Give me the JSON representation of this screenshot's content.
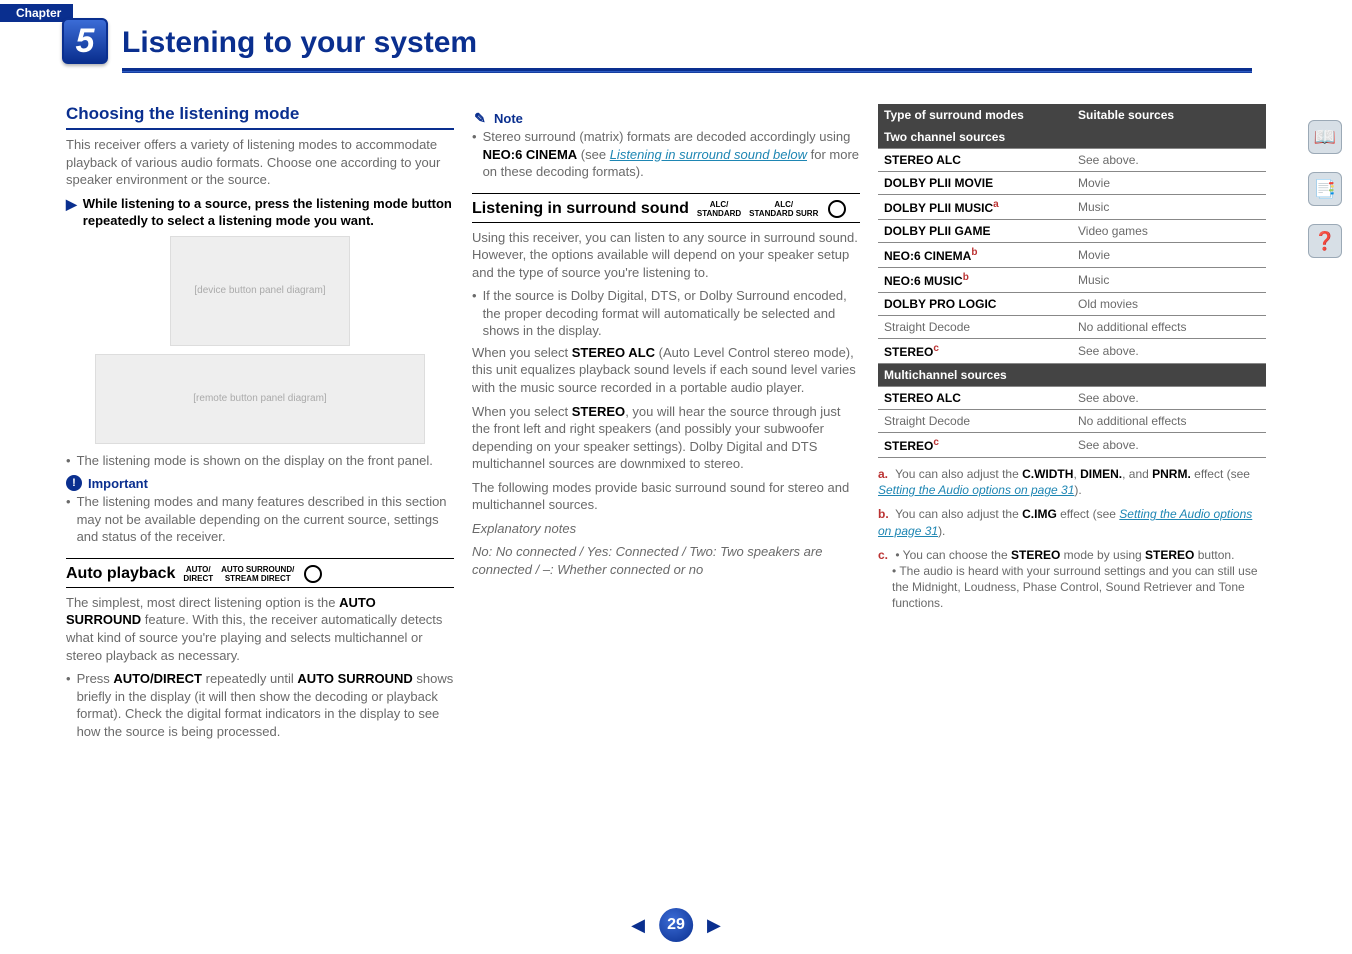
{
  "chapter_label": "Chapter",
  "chapter_number": "5",
  "page_title": "Listening to your system",
  "page_number": "29",
  "side_icons": [
    "book-icon",
    "pages-icon",
    "help-icon"
  ],
  "col1": {
    "h2": "Choosing the listening mode",
    "p1": "This receiver offers a variety of listening modes to accommodate playback of various audio formats. Choose one according to your speaker environment or the source.",
    "step": "While listening to a source, press the listening mode button repeatedly to select a listening mode you want.",
    "img1_alt": "[device button panel diagram]",
    "img2_alt": "[remote button panel diagram]",
    "bullet1": "The listening mode is shown on the display on the front panel.",
    "important_label": "Important",
    "bullet2": "The listening modes and many features described in this section may not be available depending on the current source, settings and status of the receiver.",
    "h3": "Auto playback",
    "h3_b1": "AUTO/\nDIRECT",
    "h3_b2": "AUTO SURROUND/\nSTREAM DIRECT",
    "p2a": "The simplest, most direct listening option is the ",
    "p2b": "AUTO SURROUND",
    "p2c": " feature. With this, the receiver automatically detects what kind of source you're playing and selects multichannel or stereo playback as necessary.",
    "bullet3a": "Press ",
    "bullet3b": "AUTO/DIRECT",
    "bullet3c": " repeatedly until ",
    "bullet3d": "AUTO SURROUND",
    "bullet3e": " shows briefly in the display (it will then show the decoding or playback format). Check the digital format indicators in the display to see how the source is being processed."
  },
  "col2": {
    "note_label": "Note",
    "bullet1a": "Stereo surround (matrix) formats are decoded accordingly using ",
    "bullet1b": "NEO:6 CINEMA",
    "bullet1c": " (see ",
    "link1": "Listening in surround sound below",
    "bullet1d": " for more on these decoding formats).",
    "h3": "Listening in surround sound",
    "h3_b1": "ALC/\nSTANDARD",
    "h3_b2": "ALC/\nSTANDARD SURR",
    "p1": "Using this receiver, you can listen to any source in surround sound. However, the options available will depend on your speaker setup and the type of source you're listening to.",
    "bullet2": "If the source is Dolby Digital, DTS, or Dolby Surround encoded, the proper decoding format will automatically be selected and shows in the display.",
    "p2a": "When you select ",
    "p2b": "STEREO ALC",
    "p2c": " (Auto Level Control stereo mode), this unit equalizes playback sound levels if each sound level varies with the music source recorded in a portable audio player.",
    "p3a": "When you select ",
    "p3b": "STEREO",
    "p3c": ", you will hear the source through just the front left and right speakers (and possibly your subwoofer depending on your speaker settings). Dolby Digital and DTS multichannel sources are downmixed to stereo.",
    "p4": "The following modes provide basic surround sound for stereo and multichannel sources.",
    "expl_label": "Explanatory notes",
    "expl_text": "No: No connected / Yes: Connected / Two: Two speakers are connected / –: Whether connected or no"
  },
  "col3": {
    "head1": "Type of surround modes",
    "head2": "Suitable sources",
    "sec1": "Two channel sources",
    "rows1": [
      {
        "label": "STEREO ALC",
        "sup": "",
        "val": "See above."
      },
      {
        "label": "DOLBY PLII MOVIE",
        "sup": "",
        "val": "Movie"
      },
      {
        "label": "DOLBY PLII MUSIC",
        "sup": "a",
        "val": "Music"
      },
      {
        "label": "DOLBY PLII GAME",
        "sup": "",
        "val": "Video games"
      },
      {
        "label": "NEO:6 CINEMA",
        "sup": "b",
        "val": "Movie"
      },
      {
        "label": "NEO:6 MUSIC",
        "sup": "b",
        "val": "Music"
      },
      {
        "label": "DOLBY PRO LOGIC",
        "sup": "",
        "val": "Old movies"
      },
      {
        "label": "Straight Decode",
        "plain": true,
        "sup": "",
        "val": "No additional effects"
      },
      {
        "label": "STEREO",
        "sup": "c",
        "val": "See above."
      }
    ],
    "sec2": "Multichannel sources",
    "rows2": [
      {
        "label": "STEREO ALC",
        "sup": "",
        "val": "See above."
      },
      {
        "label": "Straight Decode",
        "plain": true,
        "sup": "",
        "val": "No additional effects"
      },
      {
        "label": "STEREO",
        "sup": "c",
        "val": "See above."
      }
    ],
    "fn_a1": "You can also adjust the ",
    "fn_a2": "C.WIDTH",
    "fn_a3": ", ",
    "fn_a4": "DIMEN.",
    "fn_a5": ", and ",
    "fn_a6": "PNRM.",
    "fn_a7": " effect (see ",
    "fn_a_link": "Setting the Audio options",
    "fn_a_pg": " on page 31",
    "fn_a8": ").",
    "fn_b1": "You can also adjust the ",
    "fn_b2": "C.IMG",
    "fn_b3": " effect (see ",
    "fn_b_link": "Setting the Audio options",
    "fn_b_pg": " on page 31",
    "fn_b4": ").",
    "fn_c1": "• You can choose the ",
    "fn_c2": "STEREO",
    "fn_c3": " mode by using ",
    "fn_c4": "STEREO",
    "fn_c5": " button.",
    "fn_c6": "• The audio is heard with your surround settings and you can still use the Midnight, Loudness, Phase Control, Sound Retriever and Tone functions."
  }
}
